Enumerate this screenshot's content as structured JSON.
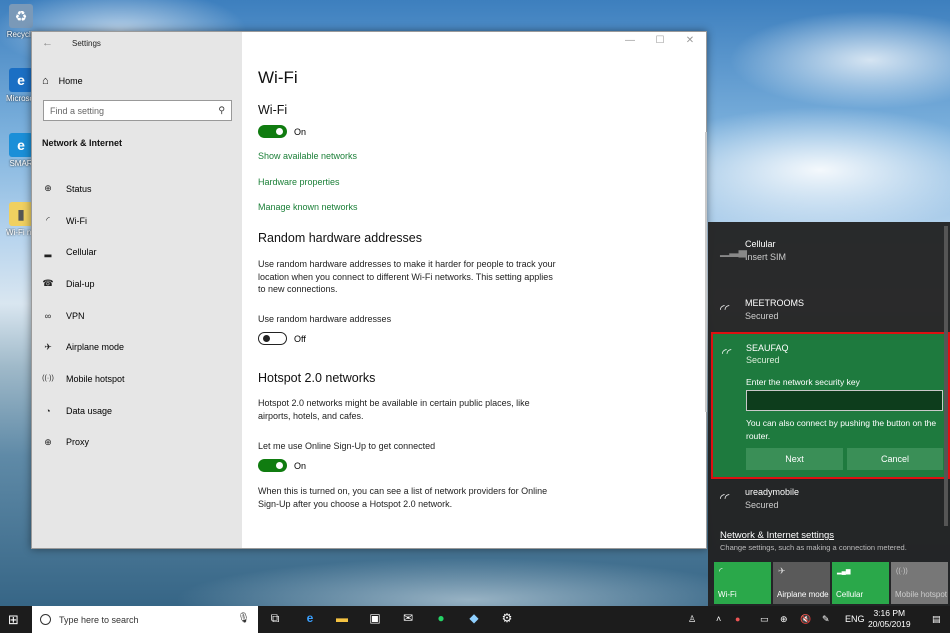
{
  "desktop": {
    "icons": [
      {
        "label": "Recycle",
        "glyph": "♻"
      },
      {
        "label": "Microsoft Edge",
        "glyph": "e"
      },
      {
        "label": "SMAR",
        "glyph": "e"
      },
      {
        "label": "Wi-Fi network",
        "glyph": "▮"
      }
    ]
  },
  "settings": {
    "window_title": "Settings",
    "home_label": "Home",
    "search_placeholder": "Find a setting",
    "section": "Network & Internet",
    "nav": [
      {
        "label": "Status",
        "icon": "globe-icon",
        "glyph": "⊕"
      },
      {
        "label": "Wi-Fi",
        "icon": "wifi-icon",
        "glyph": "◜"
      },
      {
        "label": "Cellular",
        "icon": "cellular-icon",
        "glyph": "▂"
      },
      {
        "label": "Dial-up",
        "icon": "phone-icon",
        "glyph": "☎"
      },
      {
        "label": "VPN",
        "icon": "vpn-icon",
        "glyph": "∞"
      },
      {
        "label": "Airplane mode",
        "icon": "airplane-icon",
        "glyph": "✈"
      },
      {
        "label": "Mobile hotspot",
        "icon": "hotspot-icon",
        "glyph": "((·))"
      },
      {
        "label": "Data usage",
        "icon": "data-usage-icon",
        "glyph": "◔"
      },
      {
        "label": "Proxy",
        "icon": "proxy-icon",
        "glyph": "⊕"
      }
    ],
    "content": {
      "page_title": "Wi-Fi",
      "wifi_heading": "Wi-Fi",
      "wifi_toggle": "On",
      "links": [
        "Show available networks",
        "Hardware properties",
        "Manage known networks"
      ],
      "random_heading": "Random hardware addresses",
      "random_desc": "Use random hardware addresses to make it harder for people to track your location when you connect to different Wi-Fi networks. This setting applies to new connections.",
      "random_label": "Use random hardware addresses",
      "random_toggle": "Off",
      "hotspot_heading": "Hotspot 2.0 networks",
      "hotspot_desc": "Hotspot 2.0 networks might be available in certain public places, like airports, hotels, and cafes.",
      "signup_label": "Let me use Online Sign-Up to get connected",
      "signup_toggle": "On",
      "signup_desc": "When this is turned on, you can see a list of network providers for Online Sign-Up after you choose a Hotspot 2.0 network."
    }
  },
  "flyout": {
    "cellular": {
      "name": "Cellular",
      "status": "Insert SIM"
    },
    "meetrooms": {
      "name": "MEETROOMS",
      "status": "Secured"
    },
    "active": {
      "name": "SEAUFAQ",
      "status": "Secured",
      "prompt": "Enter the network security key",
      "key_value": "",
      "hint": "You can also connect by pushing the button on the router.",
      "next": "Next",
      "cancel": "Cancel"
    },
    "uready": {
      "name": "ureadymobile",
      "status": "Secured"
    },
    "settings_link": "Network & Internet settings",
    "settings_desc": "Change settings, such as making a connection metered.",
    "tiles": [
      {
        "label": "Wi-Fi",
        "state": "on",
        "glyph": "◜"
      },
      {
        "label": "Airplane mode",
        "state": "off",
        "glyph": "✈"
      },
      {
        "label": "Cellular",
        "state": "on",
        "glyph": "▂▄▆"
      },
      {
        "label": "Mobile hotspot",
        "state": "off",
        "glyph": "((·))"
      }
    ]
  },
  "taskbar": {
    "search_placeholder": "Type here to search",
    "language": "ENG",
    "time": "3:16 PM",
    "date": "20/05/2019"
  }
}
